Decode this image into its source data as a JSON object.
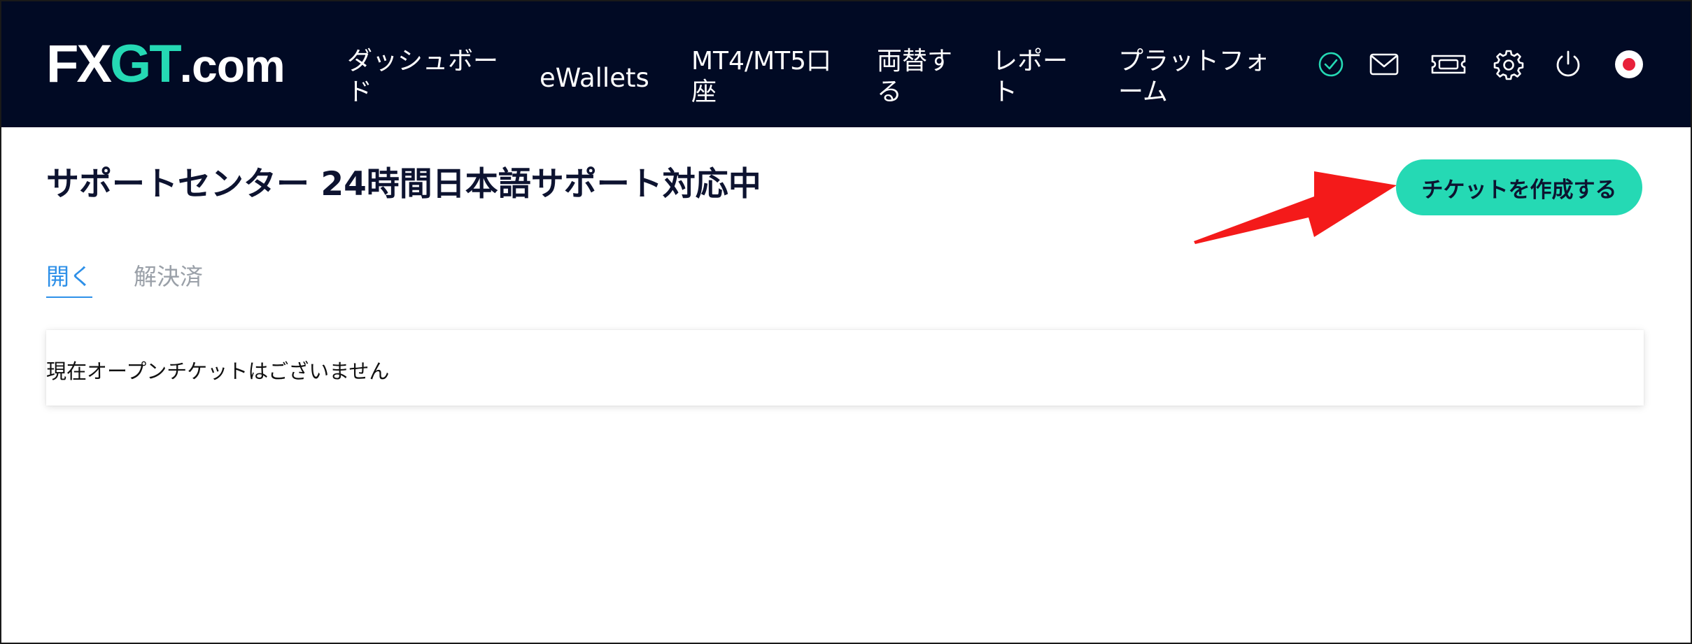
{
  "brand": {
    "logo_fx": "FX",
    "logo_gt": "GT",
    "logo_com": ".com",
    "accent_color": "#25d9b4",
    "navbar_color": "#010a24"
  },
  "nav": {
    "items": [
      {
        "line1": "ダッシュボー",
        "line2": "ド"
      },
      {
        "line1": "eWallets",
        "line2": ""
      },
      {
        "line1": "MT4/MT5口",
        "line2": "座"
      },
      {
        "line1": "両替す",
        "line2": "る"
      },
      {
        "line1": "レポー",
        "line2": "ト"
      },
      {
        "line1": "プラットフォ",
        "line2": "ーム"
      }
    ],
    "icons": [
      "verified-check-icon",
      "mail-icon",
      "ticket-icon",
      "gear-icon",
      "power-icon",
      "japan-flag-icon"
    ]
  },
  "page": {
    "title": "サポートセンター 24時間日本語サポート対応中",
    "create_ticket_label": "チケットを作成する",
    "tabs": [
      {
        "label": "開く",
        "active": true
      },
      {
        "label": "解決済",
        "active": false
      }
    ],
    "empty_message": "現在オープンチケットはございません"
  },
  "annotation": {
    "arrow_color": "#f41a1a"
  }
}
